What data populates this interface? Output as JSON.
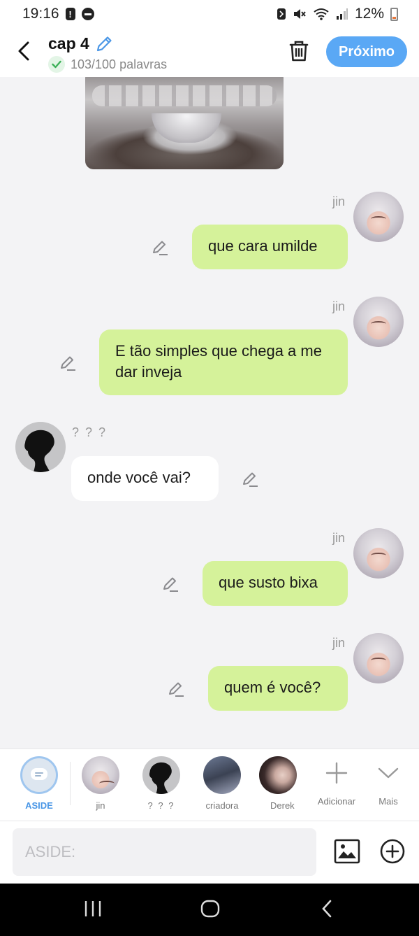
{
  "status_bar": {
    "time": "19:16",
    "battery": "12%"
  },
  "header": {
    "title": "cap 4",
    "word_count": "103/100 palavras",
    "next_label": "Próximo"
  },
  "messages": [
    {
      "side": "right",
      "sender": "jin",
      "text": "que cara umilde"
    },
    {
      "side": "right",
      "sender": "jin",
      "text": "E tão simples que chega a me dar inveja"
    },
    {
      "side": "left",
      "sender": "? ? ?",
      "text": "onde você vai?"
    },
    {
      "side": "right",
      "sender": "jin",
      "text": "que susto bixa"
    },
    {
      "side": "right",
      "sender": "jin",
      "text": "quem é você?"
    }
  ],
  "characters": [
    {
      "label": "ASIDE"
    },
    {
      "label": "jin"
    },
    {
      "label": "? ? ?"
    },
    {
      "label": "criadora"
    },
    {
      "label": "Derek"
    },
    {
      "label": "Adicionar"
    },
    {
      "label": "Mais"
    }
  ],
  "input": {
    "placeholder": "ASIDE:"
  },
  "colors": {
    "accent": "#5aa8f5",
    "bubble_green": "#d5f29a",
    "active_tab": "#4b97e6"
  }
}
